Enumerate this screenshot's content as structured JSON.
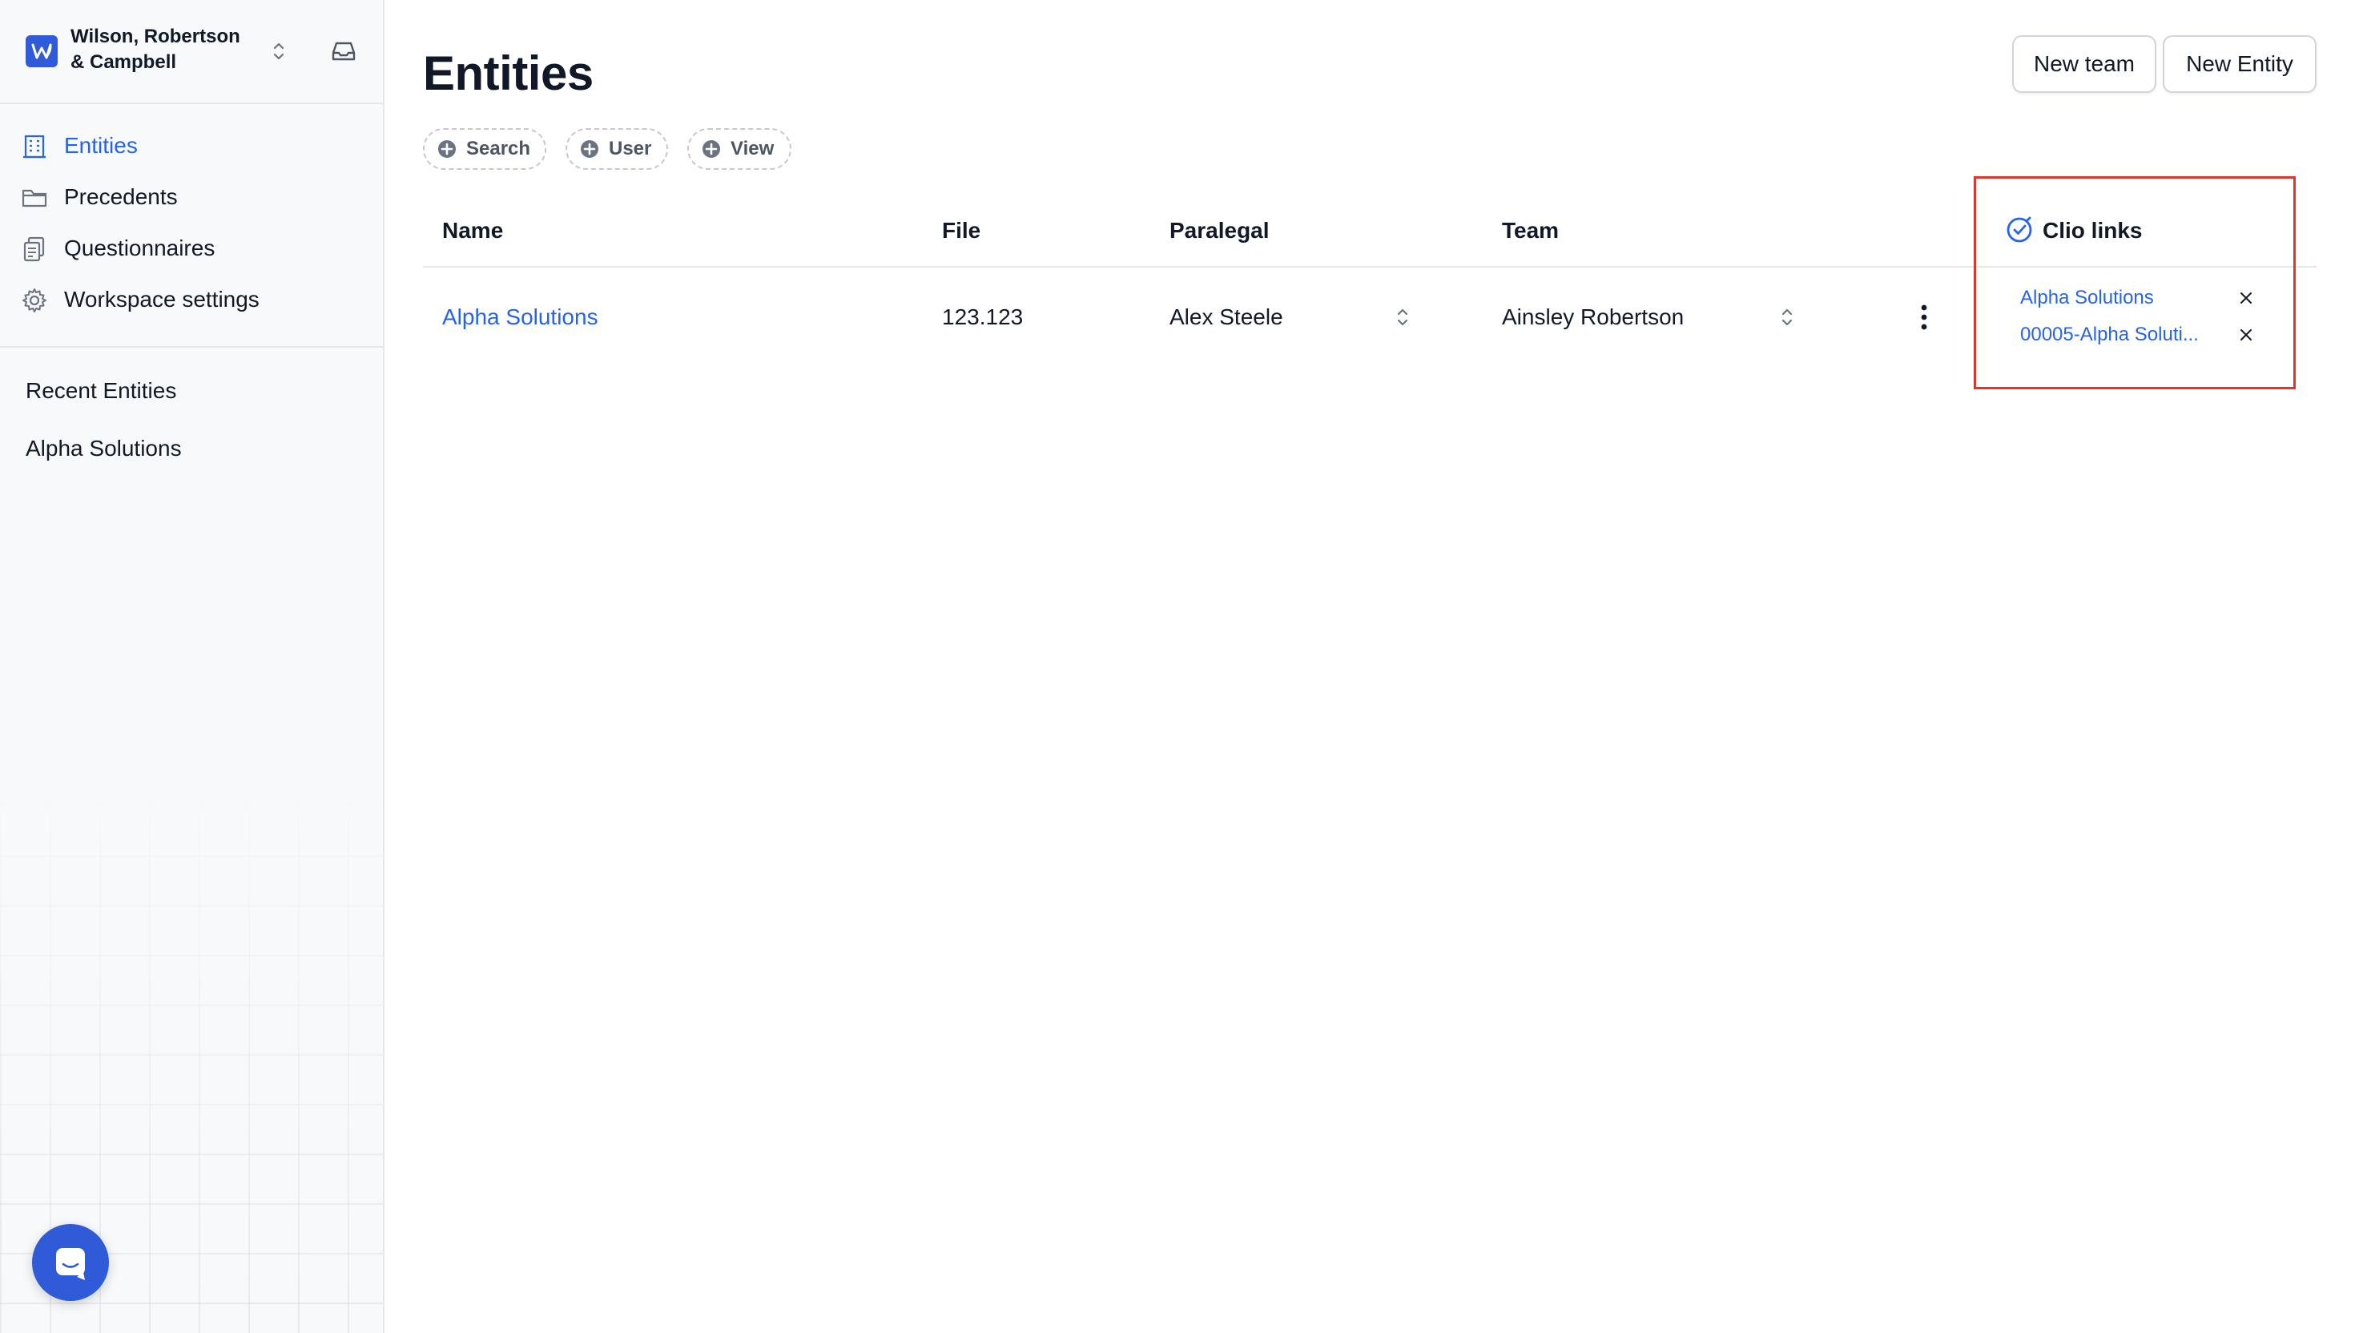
{
  "workspace": {
    "name": "Wilson, Robertson & Campbell",
    "logo_icon": "workspace-logo-icon",
    "brand_color": "#2f5bd8"
  },
  "sidebar": {
    "items": [
      {
        "label": "Entities",
        "icon": "building-icon",
        "active": true
      },
      {
        "label": "Precedents",
        "icon": "folder-icon",
        "active": false
      },
      {
        "label": "Questionnaires",
        "icon": "clipboard-icon",
        "active": false
      },
      {
        "label": "Workspace settings",
        "icon": "gear-icon",
        "active": false
      }
    ],
    "recent_title": "Recent Entities",
    "recent_items": [
      "Alpha Solutions"
    ]
  },
  "main": {
    "title": "Entities",
    "buttons": {
      "new_team": "New team",
      "new_entity": "New Entity"
    },
    "filters": [
      "Search",
      "User",
      "View"
    ],
    "table": {
      "columns": [
        "Name",
        "File",
        "Paralegal",
        "Team"
      ],
      "rows": [
        {
          "name": "Alpha Solutions",
          "file": "123.123",
          "paralegal": "Alex Steele",
          "team": "Ainsley Robertson"
        }
      ]
    },
    "clio": {
      "title": "Clio links",
      "links": [
        "Alpha Solutions",
        "00005-Alpha Soluti..."
      ]
    }
  },
  "colors": {
    "accent": "#2563eb",
    "highlight": "#e0352b"
  }
}
